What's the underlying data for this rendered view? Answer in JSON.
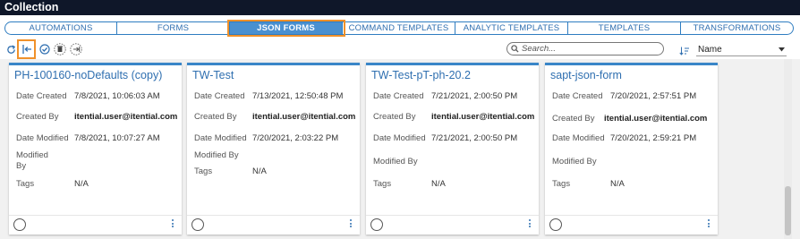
{
  "window": {
    "title": "Collection"
  },
  "tabs": [
    {
      "label": "AUTOMATIONS",
      "active": false
    },
    {
      "label": "FORMS",
      "active": false
    },
    {
      "label": "JSON FORMS",
      "active": true
    },
    {
      "label": "COMMAND TEMPLATES",
      "active": false
    },
    {
      "label": "ANALYTIC TEMPLATES",
      "active": false
    },
    {
      "label": "TEMPLATES",
      "active": false
    },
    {
      "label": "TRANSFORMATIONS",
      "active": false
    }
  ],
  "toolbar": {
    "icons": [
      "refresh-icon",
      "import-icon",
      "check-circle-icon",
      "delete-icon",
      "export-icon"
    ],
    "search_placeholder": "Search...",
    "sort_value": "Name"
  },
  "colors": {
    "accent": "#3a86c8",
    "highlight": "#f0912a",
    "header": "#0f1729"
  },
  "labels": {
    "date_created": "Date Created",
    "created_by": "Created By",
    "date_modified": "Date Modified",
    "modified_by": "Modified By",
    "modified": "Modified",
    "by": "By",
    "tags": "Tags"
  },
  "cards": [
    {
      "name": "PH-100160-noDefaults (copy)",
      "date_created": "7/8/2021, 10:06:03 AM",
      "created_by": "itential.user@itential.com",
      "date_modified": "7/8/2021, 10:07:27 AM",
      "modified_by": "",
      "tags": "N/A"
    },
    {
      "name": "TW-Test",
      "date_created": "7/13/2021, 12:50:48 PM",
      "created_by": "itential.user@itential.com",
      "date_modified": "7/20/2021, 2:03:22 PM",
      "modified_by": "",
      "tags": "N/A"
    },
    {
      "name": "TW-Test-pT-ph-20.2",
      "date_created": "7/21/2021, 2:00:50 PM",
      "created_by": "itential.user@itential.com",
      "date_modified": "7/21/2021, 2:00:50 PM",
      "modified_by": "",
      "tags": "N/A"
    },
    {
      "name": "sapt-json-form",
      "date_created": "7/20/2021, 2:57:51 PM",
      "created_by": "itential.user@itential.com",
      "date_modified": "7/20/2021, 2:59:21 PM",
      "modified_by": "",
      "tags": "N/A"
    }
  ]
}
